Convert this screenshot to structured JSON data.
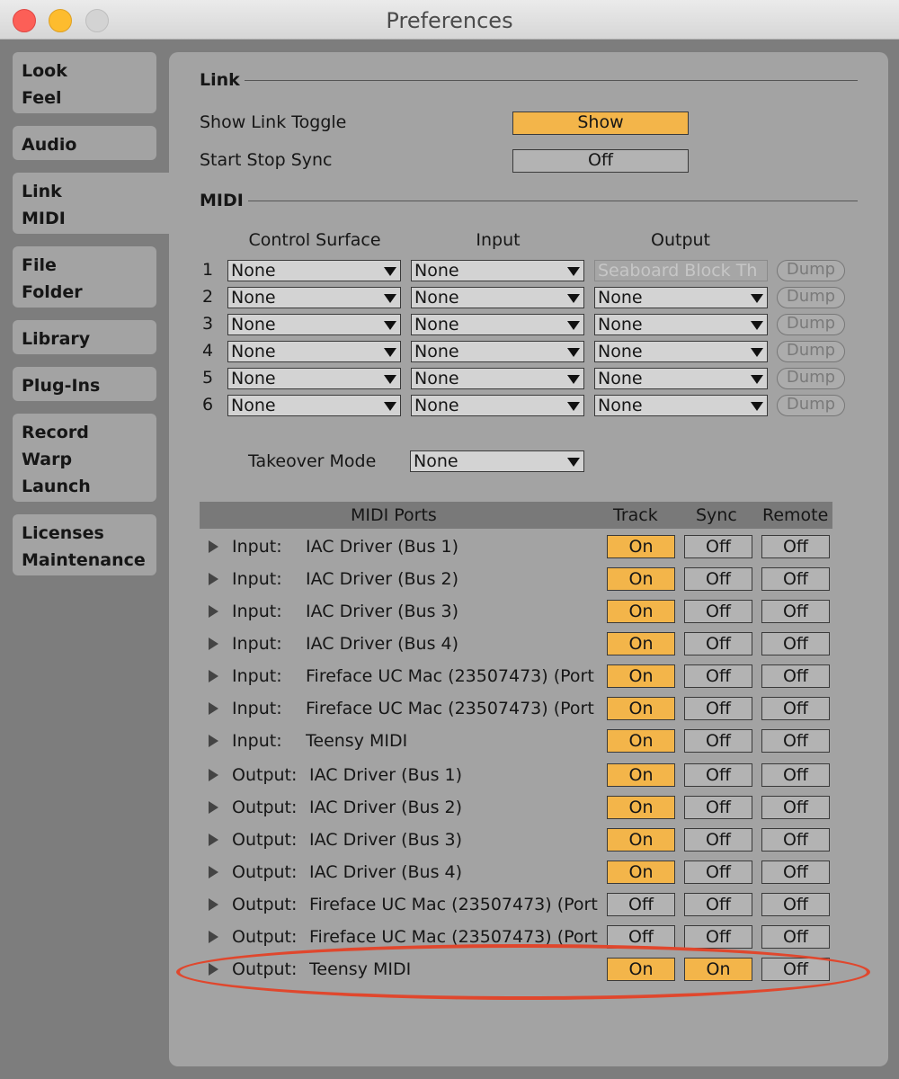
{
  "window": {
    "title": "Preferences"
  },
  "sidebar": {
    "tabs": [
      {
        "lines": [
          "Look",
          "Feel"
        ]
      },
      {
        "lines": [
          "Audio"
        ]
      },
      {
        "lines": [
          "Link",
          "MIDI"
        ]
      },
      {
        "lines": [
          "File",
          "Folder"
        ]
      },
      {
        "lines": [
          "Library"
        ]
      },
      {
        "lines": [
          "Plug-Ins"
        ]
      },
      {
        "lines": [
          "Record",
          "Warp",
          "Launch"
        ]
      },
      {
        "lines": [
          "Licenses",
          "Maintenance"
        ]
      }
    ]
  },
  "link": {
    "section_title": "Link",
    "show_link_toggle_label": "Show Link Toggle",
    "show_link_toggle_value": "Show",
    "start_stop_sync_label": "Start Stop Sync",
    "start_stop_sync_value": "Off"
  },
  "midi": {
    "section_title": "MIDI",
    "col_control_surface": "Control Surface",
    "col_input": "Input",
    "col_output": "Output",
    "dump_label": "Dump",
    "rows": [
      {
        "num": "1",
        "surface": "None",
        "input": "None",
        "output": "Seaboard Block Th"
      },
      {
        "num": "2",
        "surface": "None",
        "input": "None",
        "output": "None"
      },
      {
        "num": "3",
        "surface": "None",
        "input": "None",
        "output": "None"
      },
      {
        "num": "4",
        "surface": "None",
        "input": "None",
        "output": "None"
      },
      {
        "num": "5",
        "surface": "None",
        "input": "None",
        "output": "None"
      },
      {
        "num": "6",
        "surface": "None",
        "input": "None",
        "output": "None"
      }
    ],
    "takeover_label": "Takeover Mode",
    "takeover_value": "None"
  },
  "ports": {
    "header": {
      "ports": "MIDI Ports",
      "track": "Track",
      "sync": "Sync",
      "remote": "Remote"
    },
    "rows": [
      {
        "dir": "Input:",
        "name": "IAC Driver (Bus 1)",
        "track": "On",
        "sync": "Off",
        "remote": "Off"
      },
      {
        "dir": "Input:",
        "name": "IAC Driver (Bus 2)",
        "track": "On",
        "sync": "Off",
        "remote": "Off"
      },
      {
        "dir": "Input:",
        "name": "IAC Driver (Bus 3)",
        "track": "On",
        "sync": "Off",
        "remote": "Off"
      },
      {
        "dir": "Input:",
        "name": "IAC Driver (Bus 4)",
        "track": "On",
        "sync": "Off",
        "remote": "Off"
      },
      {
        "dir": "Input:",
        "name": "Fireface UC Mac (23507473) (Port",
        "track": "On",
        "sync": "Off",
        "remote": "Off"
      },
      {
        "dir": "Input:",
        "name": "Fireface UC Mac (23507473) (Port",
        "track": "On",
        "sync": "Off",
        "remote": "Off"
      },
      {
        "dir": "Input:",
        "name": "Teensy MIDI",
        "track": "On",
        "sync": "Off",
        "remote": "Off"
      },
      {
        "dir": "Output:",
        "name": "IAC Driver (Bus 1)",
        "track": "On",
        "sync": "Off",
        "remote": "Off"
      },
      {
        "dir": "Output:",
        "name": "IAC Driver (Bus 2)",
        "track": "On",
        "sync": "Off",
        "remote": "Off"
      },
      {
        "dir": "Output:",
        "name": "IAC Driver (Bus 3)",
        "track": "On",
        "sync": "Off",
        "remote": "Off"
      },
      {
        "dir": "Output:",
        "name": "IAC Driver (Bus 4)",
        "track": "On",
        "sync": "Off",
        "remote": "Off"
      },
      {
        "dir": "Output:",
        "name": "Fireface UC Mac (23507473) (Port",
        "track": "Off",
        "sync": "Off",
        "remote": "Off"
      },
      {
        "dir": "Output:",
        "name": "Fireface UC Mac (23507473) (Port",
        "track": "Off",
        "sync": "Off",
        "remote": "Off"
      },
      {
        "dir": "Output:",
        "name": "Teensy MIDI",
        "track": "On",
        "sync": "On",
        "remote": "Off"
      }
    ]
  },
  "colors": {
    "on": "#f3b54a",
    "off": "#b3b3b3",
    "highlight": "#e0472d"
  }
}
